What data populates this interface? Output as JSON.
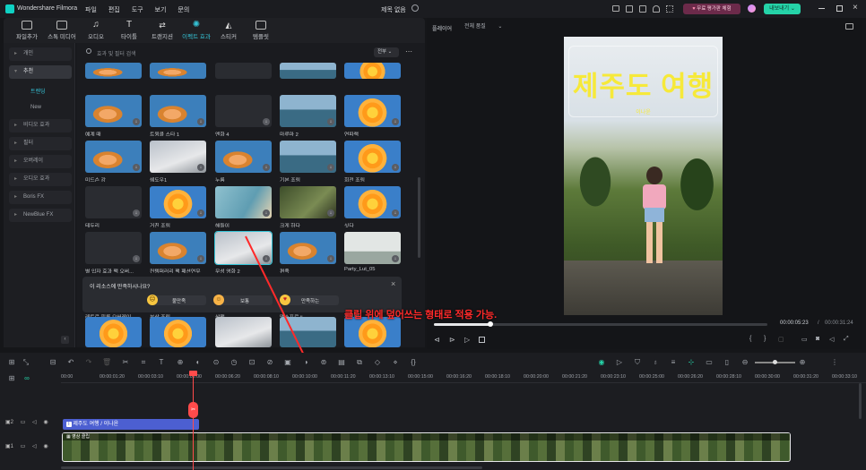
{
  "app": {
    "name": "Wondershare Filmora",
    "project_title": "제목 없음"
  },
  "menu": [
    "파일",
    "편집",
    "도구",
    "보기",
    "문의"
  ],
  "titlebar_right": {
    "promo": "무료 평가판 체험",
    "export_button": "내보내기"
  },
  "toolbar": [
    {
      "label": "파일추가",
      "icon": "import-icon"
    },
    {
      "label": "스톡 미디어",
      "icon": "stock-media-icon"
    },
    {
      "label": "오디오",
      "icon": "music-note-icon"
    },
    {
      "label": "타이틀",
      "icon": "title-t-icon"
    },
    {
      "label": "트랜지션",
      "icon": "transition-icon"
    },
    {
      "label": "이펙트 효과",
      "icon": "effects-sparkle-icon",
      "active": true
    },
    {
      "label": "스티커",
      "icon": "sticker-icon"
    },
    {
      "label": "템플릿",
      "icon": "template-icon"
    }
  ],
  "sidebar": {
    "items": [
      "개인",
      "추천",
      "비디오 효과",
      "필터",
      "오버레이",
      "오디오 효과",
      "Boris FX",
      "NewBlue FX"
    ],
    "sub_items": [
      "트렌딩",
      "New"
    ],
    "selected_item": "추천",
    "selected_sub": "트렌딩"
  },
  "search": {
    "placeholder": "효과 및 필터 검색",
    "filter": "전부"
  },
  "effects": [
    {
      "label": "예계 때",
      "style": "girl"
    },
    {
      "label": "트윙클 스타 1",
      "style": "girl"
    },
    {
      "label": "엔화 4",
      "style": "dark"
    },
    {
      "label": "마루마 2",
      "style": "sea"
    },
    {
      "label": "연파랙",
      "style": "flower"
    },
    {
      "label": "미드슨 강",
      "style": "girl"
    },
    {
      "label": "쉐도우1",
      "style": "light"
    },
    {
      "label": "누름",
      "style": "girl"
    },
    {
      "label": "기본 조림",
      "style": "sea"
    },
    {
      "label": "회전 조림",
      "style": "flower"
    },
    {
      "label": "테두리",
      "style": "dark"
    },
    {
      "label": "거친 조림",
      "style": "flower"
    },
    {
      "label": "해들이",
      "style": "light2"
    },
    {
      "label": "크게 하다",
      "style": "green"
    },
    {
      "label": "싯다",
      "style": "flower"
    },
    {
      "label": "별 입자 효과 팩 오버...",
      "style": "dark"
    },
    {
      "label": "컨템퍼러리 팩 패션연무",
      "style": "girl"
    },
    {
      "label": "무성 영화 2",
      "style": "light"
    },
    {
      "label": "편족",
      "style": "girl"
    },
    {
      "label": "Party_Lut_05",
      "style": "people"
    },
    {
      "label": "레트로 필름 오버레이...",
      "style": "green"
    },
    {
      "label": "분산 조림",
      "style": "girl"
    },
    {
      "label": "산맥",
      "style": "green"
    },
    {
      "label": "맥스프로 ii",
      "style": "flower"
    },
    {
      "label": "옹 리플",
      "style": "flower"
    }
  ],
  "feedback": {
    "question": "이 리소스에 만족하시나요?",
    "options": [
      "불만족",
      "보통",
      "만족하는"
    ]
  },
  "annotation": {
    "text": "클립 위에 덮어쓰는 형태로 적용 가능."
  },
  "preview": {
    "player_label": "플레이어",
    "quality": "전체 품질",
    "overlay_title": "제주도 여행",
    "overlay_subtitle": "이나윤",
    "current_time": "00:00:05:23",
    "separator": "/",
    "total_time": "00:00:31:24",
    "progress": 0.17
  },
  "timeline": {
    "ruler": [
      "00:00",
      "00:00:01:20",
      "00:00:03:10",
      "00:00:05:00",
      "00:00:06:20",
      "00:00:08:10",
      "00:00:10:00",
      "00:00:11:20",
      "00:00:13:10",
      "00:00:15:00",
      "00:00:16:20",
      "00:00:18:10",
      "00:00:20:00",
      "00:00:21:20",
      "00:00:23:10",
      "00:00:25:00",
      "00:00:26:20",
      "00:00:28:10",
      "00:00:30:00",
      "00:00:31:20",
      "00:00:33:10"
    ],
    "title_clip": "제주도 여행 / 이나윤",
    "video_clip": "영상 클립",
    "track_numbers": [
      "2",
      "1"
    ]
  },
  "colors": {
    "accent": "#35c3d6",
    "annotation": "#ff2a2a",
    "title_yellow": "#f6e93a",
    "title_clip": "#4c5fd1"
  }
}
